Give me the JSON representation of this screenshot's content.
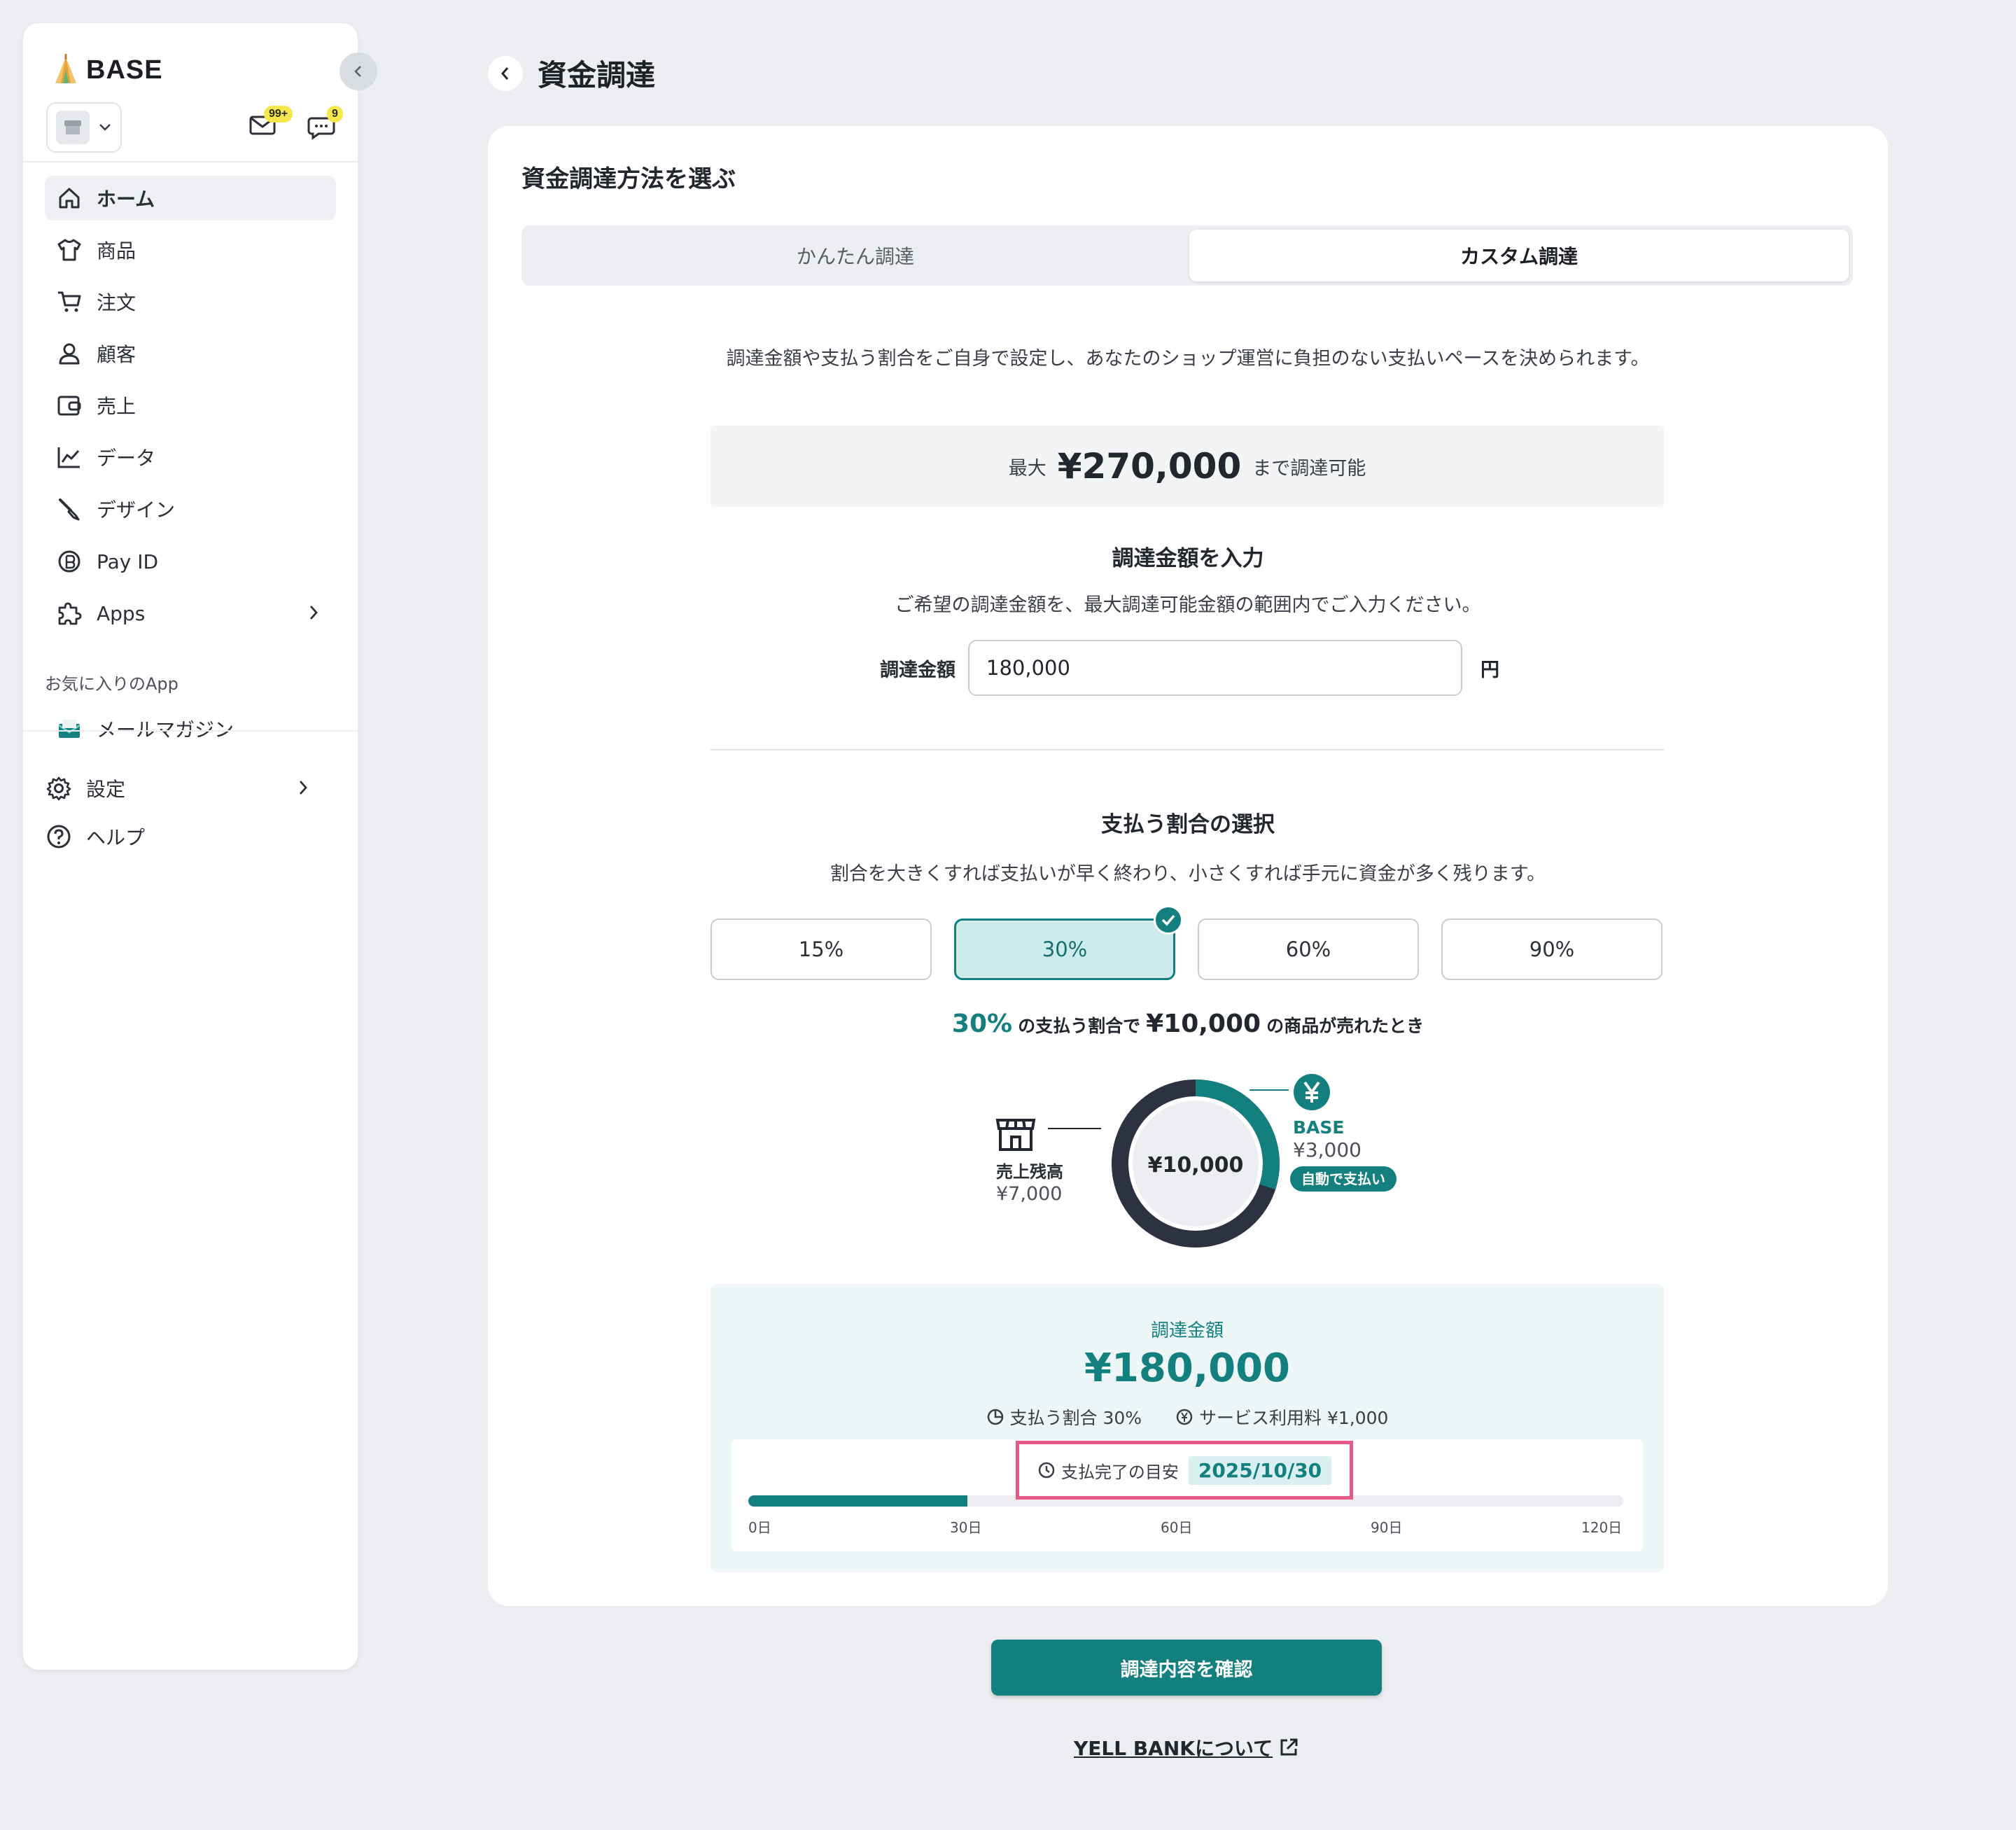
{
  "sidebar": {
    "logo": "BASE",
    "mail_badge": "99+",
    "chat_badge": "9",
    "items": [
      {
        "label": "ホーム",
        "icon": "home-icon"
      },
      {
        "label": "商品",
        "icon": "shirt-icon"
      },
      {
        "label": "注文",
        "icon": "cart-icon"
      },
      {
        "label": "顧客",
        "icon": "person-icon"
      },
      {
        "label": "売上",
        "icon": "wallet-icon"
      },
      {
        "label": "データ",
        "icon": "chart-line-icon"
      },
      {
        "label": "デザイン",
        "icon": "brush-icon"
      },
      {
        "label": "Pay ID",
        "icon": "payid-icon"
      },
      {
        "label": "Apps",
        "icon": "puzzle-icon"
      }
    ],
    "favorites_title": "お気に入りのApp",
    "favorites": [
      {
        "label": "メールマガジン",
        "icon": "mail-magazine-icon"
      }
    ],
    "settings_label": "設定",
    "help_label": "ヘルプ"
  },
  "page": {
    "title": "資金調達"
  },
  "card": {
    "title": "資金調達方法を選ぶ",
    "tabs": [
      {
        "label": "かんたん調達",
        "active": false
      },
      {
        "label": "カスタム調達",
        "active": true
      }
    ],
    "description": "調達金額や支払う割合をご自身で設定し、あなたのショップ運営に負担のない支払いペースを決められます。",
    "max": {
      "prefix": "最大",
      "amount": "¥270,000",
      "suffix": "まで調達可能"
    },
    "input_section": {
      "title": "調達金額を入力",
      "description": "ご希望の調達金額を、最大調達可能金額の範囲内でご入力ください。",
      "label": "調達金額",
      "value": "180,000",
      "unit": "円"
    },
    "ratio_section": {
      "title": "支払う割合の選択",
      "description": "割合を大きくすれば支払いが早く終わり、小さくすれば手元に資金が多く残ります。",
      "options": [
        "15%",
        "30%",
        "60%",
        "90%"
      ],
      "selected": "30%"
    },
    "example": {
      "pct": "30%",
      "text1": "の支払う割合で",
      "amount": "¥10,000",
      "text2": "の商品が売れたとき",
      "center": "¥10,000",
      "store_label": "売上残高",
      "store_amount": "¥7,000",
      "base_label": "BASE",
      "base_amount": "¥3,000",
      "auto_label": "自動で支払い",
      "share_fraction": 0.3,
      "colors": {
        "teal": "#137f7f",
        "dark": "#2d3240"
      }
    },
    "summary": {
      "label": "調達金額",
      "amount": "¥180,000",
      "ratio_text": "支払う割合 30%",
      "fee_text": "サービス利用料 ¥1,000",
      "eta_label": "支払完了の目安",
      "eta_date": "2025/10/30",
      "progress_fraction": 0.25,
      "ticks": [
        "0日",
        "30日",
        "60日",
        "90日",
        "120日"
      ]
    }
  },
  "actions": {
    "confirm": "調達内容を確認",
    "about": "YELL BANKについて"
  },
  "colors": {
    "accent": "#137f7f",
    "highlight": "#e65a86",
    "badge": "#f6e84b"
  }
}
